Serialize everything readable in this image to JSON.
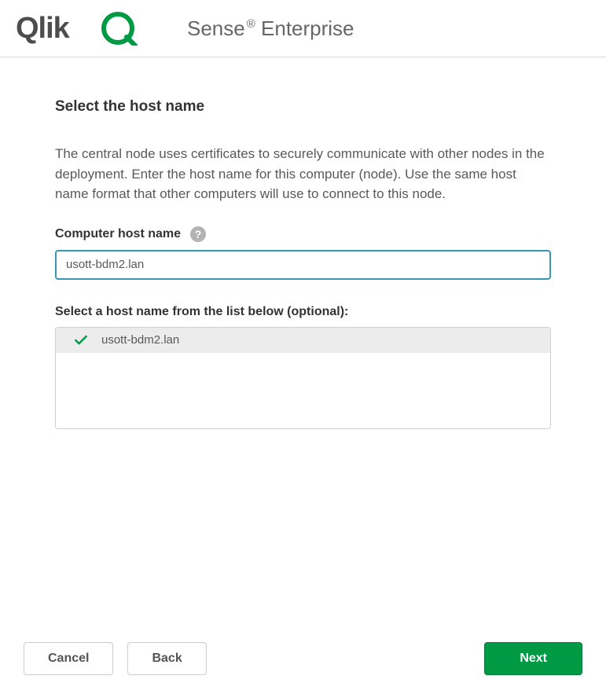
{
  "header": {
    "logo_text": "Qlik",
    "app_title_left": "Sense",
    "app_title_right": " Enterprise"
  },
  "page": {
    "title": "Select the host name",
    "instructions": "The central node uses certificates to securely communicate with other nodes in the deployment. Enter the host name for this computer (node). Use the same host name format that other computers will use to connect to this node.",
    "host_label": "Computer host name",
    "host_value": "usott-bdm2.lan",
    "optional_label": "Select a host name from the list below (optional):",
    "host_options": [
      {
        "label": "usott-bdm2.lan",
        "selected": true
      }
    ]
  },
  "footer": {
    "cancel": "Cancel",
    "back": "Back",
    "next": "Next"
  }
}
